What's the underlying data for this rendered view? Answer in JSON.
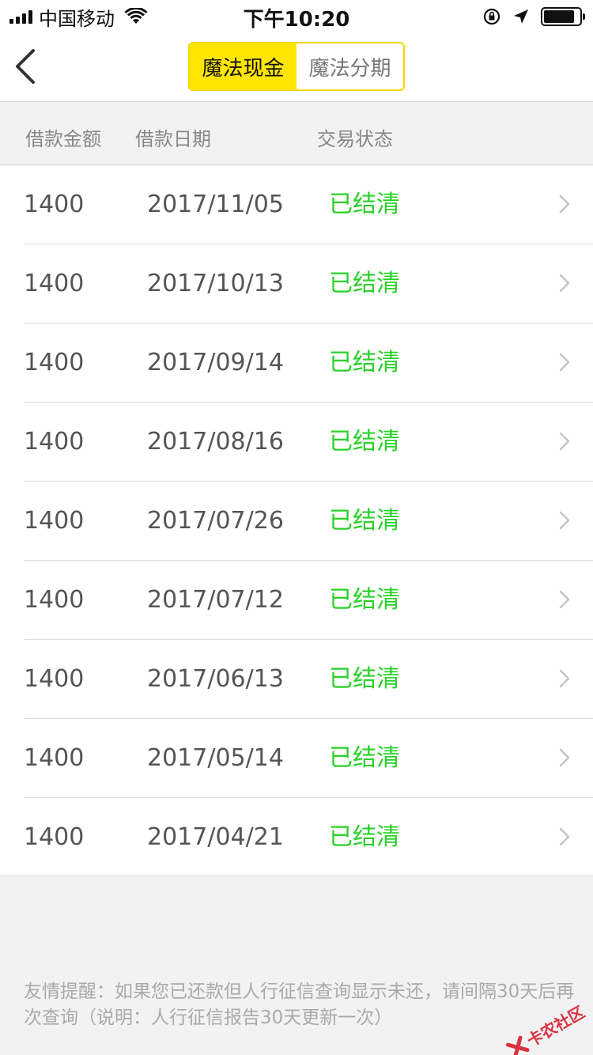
{
  "status_bar": {
    "carrier": "中国移动",
    "time": "下午10:20"
  },
  "nav": {
    "tabs": [
      {
        "label": "魔法现金",
        "active": true
      },
      {
        "label": "魔法分期",
        "active": false
      }
    ]
  },
  "table": {
    "headers": [
      "借款金额",
      "借款日期",
      "交易状态"
    ],
    "rows": [
      {
        "amount": "1400",
        "date": "2017/11/05",
        "status": "已结清"
      },
      {
        "amount": "1400",
        "date": "2017/10/13",
        "status": "已结清"
      },
      {
        "amount": "1400",
        "date": "2017/09/14",
        "status": "已结清"
      },
      {
        "amount": "1400",
        "date": "2017/08/16",
        "status": "已结清"
      },
      {
        "amount": "1400",
        "date": "2017/07/26",
        "status": "已结清"
      },
      {
        "amount": "1400",
        "date": "2017/07/12",
        "status": "已结清"
      },
      {
        "amount": "1400",
        "date": "2017/06/13",
        "status": "已结清"
      },
      {
        "amount": "1400",
        "date": "2017/05/14",
        "status": "已结清"
      },
      {
        "amount": "1400",
        "date": "2017/04/21",
        "status": "已结清"
      }
    ]
  },
  "footer": {
    "note": "友情提醒：如果您已还款但人行征信查询显示未还，请间隔30天后再次查询（说明：人行征信报告30天更新一次）"
  },
  "watermark": {
    "text": "卡农社区"
  },
  "colors": {
    "accent_yellow": "#ffe600",
    "status_green": "#2ad12a"
  },
  "icons": {
    "back": "chevron-left-icon",
    "row": "chevron-right-icon",
    "wifi": "wifi-icon",
    "battery": "battery-icon",
    "location": "location-arrow-icon",
    "lock": "orientation-lock-icon"
  }
}
